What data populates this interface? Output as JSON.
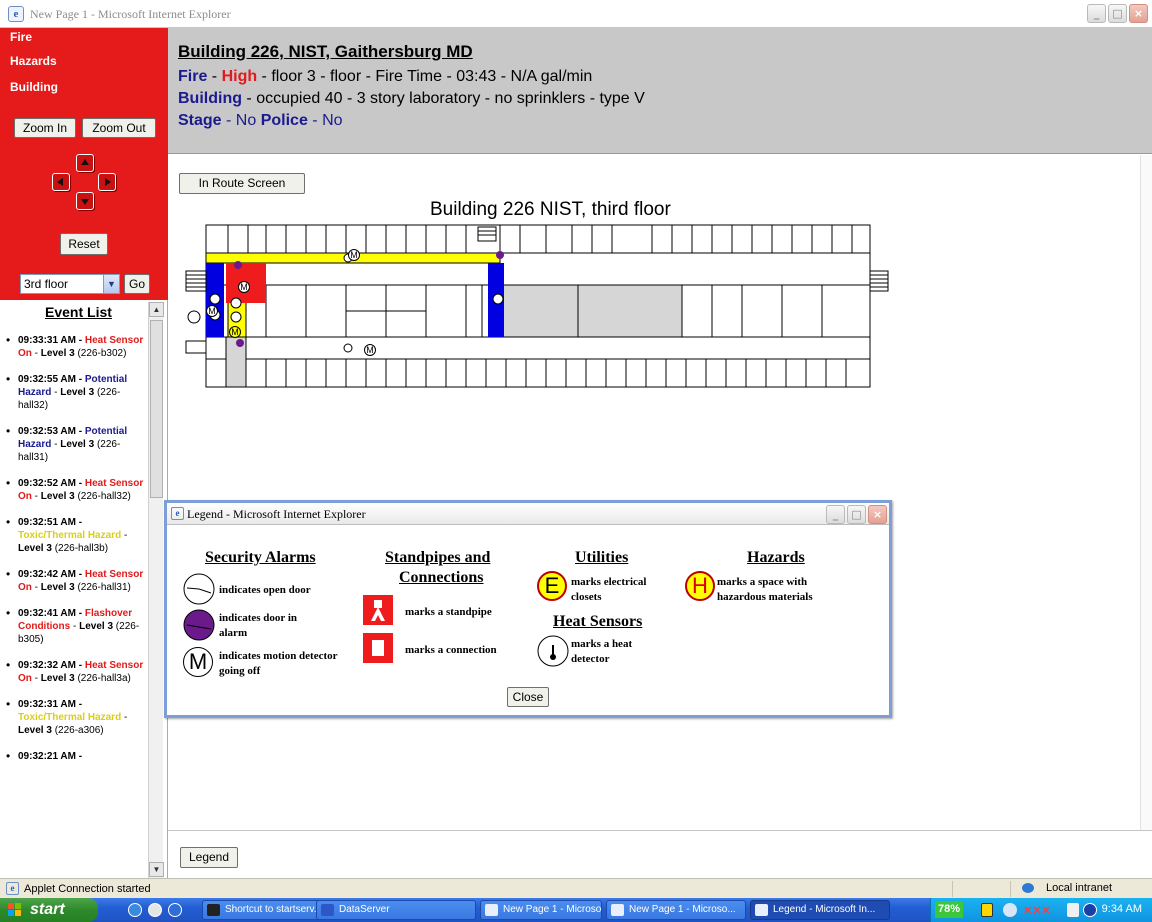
{
  "window": {
    "title": "New Page 1 - Microsoft Internet Explorer",
    "ie_icon": "e"
  },
  "nav": {
    "fire": "Fire",
    "hazards": "Hazards",
    "building": "Building"
  },
  "controls": {
    "zoom_in": "Zoom In",
    "zoom_out": "Zoom Out",
    "reset": "Reset",
    "floor": "3rd floor",
    "go": "Go"
  },
  "header": {
    "title": "Building 226, NIST, Gaithersburg MD",
    "fire_label": "Fire",
    "fire_sep1": " - ",
    "fire_level": "High",
    "fire_rest": " - floor 3 - floor - Fire Time - 03:43 - N/A gal/min",
    "building_label": "Building",
    "building_rest": " - occupied 40 - 3 story laboratory - no sprinklers - type V",
    "stage_label": "Stage",
    "stage_value": " - No ",
    "police_label": "Police",
    "police_value": " - No"
  },
  "main": {
    "route_button": "In Route Screen",
    "map_title": "Building 226 NIST, third floor",
    "legend_button": "Legend"
  },
  "event_list": {
    "title": "Event List",
    "events": [
      {
        "time": "09:33:31 AM - ",
        "desc": "Heat Sensor On",
        "color": "#e01b1b",
        "sep": " - ",
        "level": "Level 3",
        "loc": " (226-b302)"
      },
      {
        "time": "09:32:55 AM - ",
        "desc": "Potential Hazard",
        "color": "#1b1b8f",
        "sep": " - ",
        "level": "Level 3",
        "loc": " (226-hall32)"
      },
      {
        "time": "09:32:53 AM - ",
        "desc": "Potential Hazard",
        "color": "#1b1b8f",
        "sep": " - ",
        "level": "Level 3",
        "loc": " (226-hall31)"
      },
      {
        "time": "09:32:52 AM - ",
        "desc": "Heat Sensor On",
        "color": "#e01b1b",
        "sep": " - ",
        "level": "Level 3",
        "loc": " (226-hall32)"
      },
      {
        "time": "09:32:51 AM - ",
        "desc": "Toxic/Thermal Hazard",
        "color": "#d9cf1a",
        "sep": " - ",
        "level": "Level 3",
        "loc": " (226-hall3b)"
      },
      {
        "time": "09:32:42 AM - ",
        "desc": "Heat Sensor On",
        "color": "#e01b1b",
        "sep": " - ",
        "level": "Level 3",
        "loc": " (226-hall31)"
      },
      {
        "time": "09:32:41 AM - ",
        "desc": "Flashover Conditions",
        "color": "#e01b1b",
        "sep": " - ",
        "level": "Level 3",
        "loc": " (226-b305)"
      },
      {
        "time": "09:32:32 AM - ",
        "desc": "Heat Sensor On",
        "color": "#e01b1b",
        "sep": " - ",
        "level": "Level 3",
        "loc": " (226-hall3a)"
      },
      {
        "time": "09:32:31 AM - ",
        "desc": "Toxic/Thermal Hazard",
        "color": "#d9cf1a",
        "sep": " - ",
        "level": "Level 3",
        "loc": " (226-a306)"
      },
      {
        "time": "09:32:21 AM - ",
        "desc": "",
        "color": "#000000",
        "sep": "",
        "level": "",
        "loc": ""
      }
    ]
  },
  "legend": {
    "title": "Legend - Microsoft Internet Explorer",
    "security": {
      "heading": "Security Alarms",
      "open_door": "indicates open door",
      "door_alarm": "indicates door in alarm",
      "motion": "indicates motion detector going off",
      "motion_glyph": "M"
    },
    "standpipes": {
      "heading_line1": "Standpipes and",
      "heading_line2": "Connections",
      "standpipe": "marks a standpipe",
      "connection": "marks a connection"
    },
    "utilities": {
      "heading": "Utilities",
      "electrical": "marks electrical closets",
      "glyph": "E"
    },
    "heat": {
      "heading": "Heat Sensors",
      "detector": "marks a heat detector"
    },
    "hazards": {
      "heading": "Hazards",
      "text": "marks a space with hazardous materials",
      "glyph": "H"
    },
    "close": "Close"
  },
  "status_bar": {
    "text": "Applet Connection started",
    "zone": "Local intranet"
  },
  "taskbar": {
    "start": "start",
    "items": [
      "Shortcut to startserv...",
      "DataServer",
      "New Page 1 - Microso...",
      "New Page 1 - Microso...",
      "Legend - Microsoft In..."
    ],
    "battery": "78%",
    "clock": "9:34 AM"
  },
  "colors": {
    "panel_red": "#e51a1a",
    "header_gray": "#c8c8c8",
    "hall_yellow": "#ffff00",
    "stair_blue": "#0000e0",
    "fire_red": "#ee1c1c",
    "alarm_purple": "#6a1a8a"
  },
  "map": {
    "motion_glyph": "M"
  }
}
